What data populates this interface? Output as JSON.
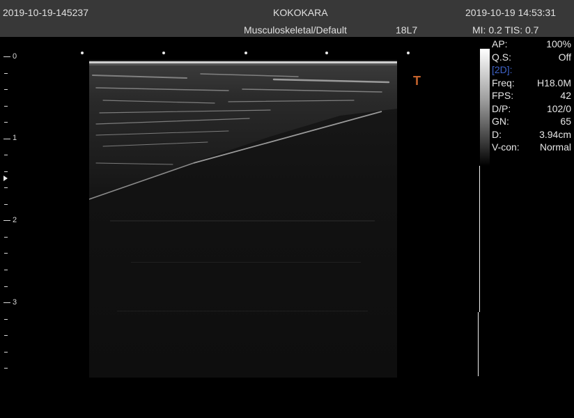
{
  "header": {
    "image_id": "2019-10-19-145237",
    "hospital": "KOKOKARA",
    "datetime": "2019-10-19 14:53:31",
    "preset": "Musculoskeletal/Default",
    "probe": "18L7",
    "mi_tis": "MI:  0.2  TIS:  0.7"
  },
  "depth_scale": {
    "labels": [
      "0",
      "1",
      "2",
      "3"
    ]
  },
  "orientation_marker": "T",
  "parameters": {
    "ap": {
      "label": "AP:",
      "value": "100%"
    },
    "qs": {
      "label": "Q.S:",
      "value": "Off"
    },
    "mode": "[2D]:",
    "freq": {
      "label": "Freq:",
      "value": "H18.0M"
    },
    "fps": {
      "label": "FPS:",
      "value": "42"
    },
    "dp": {
      "label": "D/P:",
      "value": "102/0"
    },
    "gn": {
      "label": "GN:",
      "value": "65"
    },
    "d": {
      "label": "D:",
      "value": "3.94cm"
    },
    "vcon": {
      "label": "V-con:",
      "value": "Normal"
    }
  }
}
